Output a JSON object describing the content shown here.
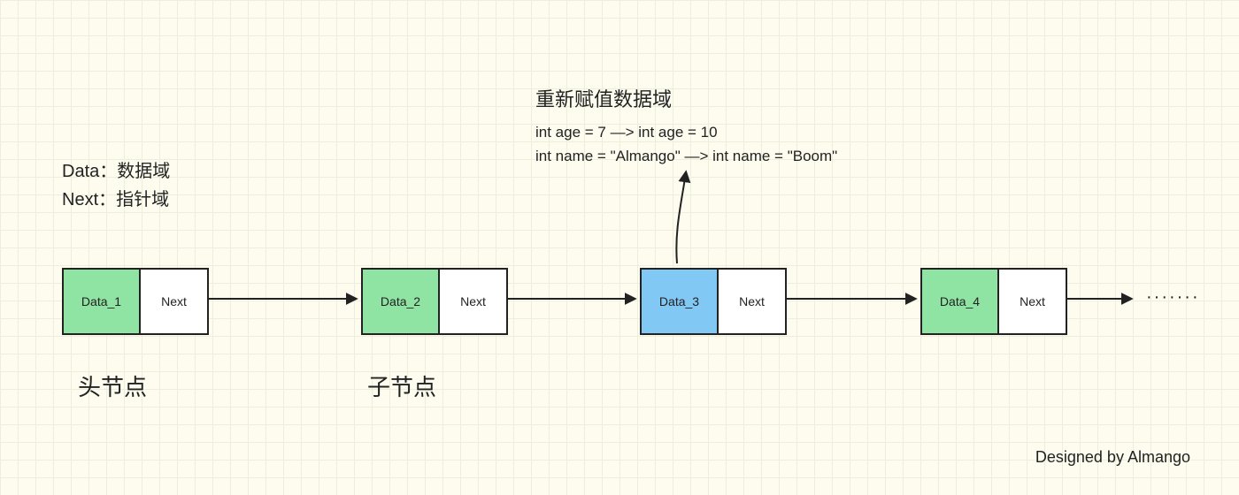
{
  "legend": {
    "data_label": "Data：数据域",
    "next_label": "Next：指针域"
  },
  "annotation": {
    "title": "重新赋值数据域",
    "line1": "int age = 7  —>  int age = 10",
    "line2": "int name = \"Almango\"  —>  int name = \"Boom\""
  },
  "nodes": {
    "n1": {
      "data": "Data_1",
      "next": "Next",
      "color": "green"
    },
    "n2": {
      "data": "Data_2",
      "next": "Next",
      "color": "green"
    },
    "n3": {
      "data": "Data_3",
      "next": "Next",
      "color": "blue"
    },
    "n4": {
      "data": "Data_4",
      "next": "Next",
      "color": "green"
    }
  },
  "captions": {
    "head": "头节点",
    "child": "子节点"
  },
  "ellipsis": "·······",
  "credit": "Designed by Almango"
}
